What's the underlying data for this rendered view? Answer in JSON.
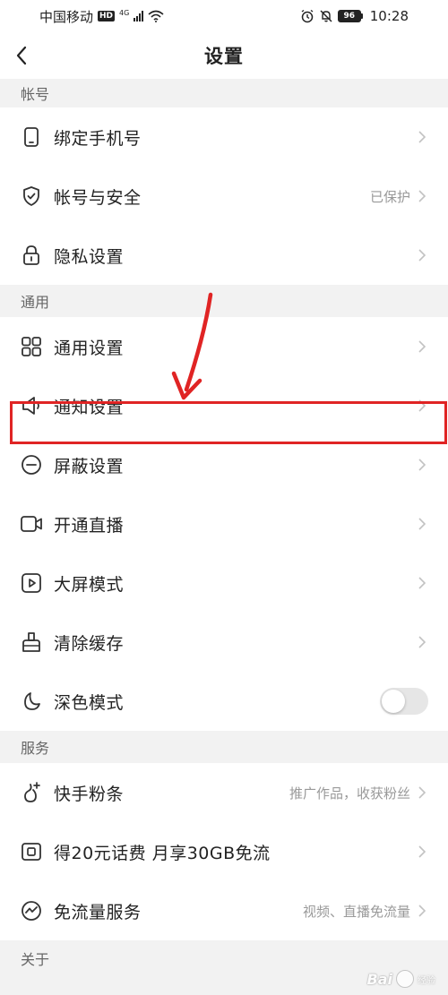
{
  "status_bar": {
    "carrier": "中国移动",
    "hd": "HD",
    "network": "4G",
    "battery": "96",
    "time": "10:28"
  },
  "nav": {
    "title": "设置"
  },
  "sections": {
    "account": {
      "header": "帐号",
      "items": [
        {
          "label": "绑定手机号",
          "value": "",
          "icon": "phone-icon"
        },
        {
          "label": "帐号与安全",
          "value": "已保护",
          "icon": "shield-check-icon"
        },
        {
          "label": "隐私设置",
          "value": "",
          "icon": "lock-icon"
        }
      ]
    },
    "general": {
      "header": "通用",
      "items": [
        {
          "label": "通用设置",
          "value": "",
          "icon": "grid-icon"
        },
        {
          "label": "通知设置",
          "value": "",
          "icon": "speaker-icon"
        },
        {
          "label": "屏蔽设置",
          "value": "",
          "icon": "block-minus-icon"
        },
        {
          "label": "开通直播",
          "value": "",
          "icon": "video-camera-icon"
        },
        {
          "label": "大屏模式",
          "value": "",
          "icon": "play-screen-icon"
        },
        {
          "label": "清除缓存",
          "value": "",
          "icon": "brush-icon"
        },
        {
          "label": "深色模式",
          "value": "",
          "icon": "moon-icon",
          "toggle": false
        }
      ]
    },
    "services": {
      "header": "服务",
      "items": [
        {
          "label": "快手粉条",
          "value": "推广作品，收获粉丝",
          "icon": "flame-plus-icon"
        },
        {
          "label": "得20元话费 月享30GB免流",
          "value": "",
          "icon": "sim-card-icon"
        },
        {
          "label": "免流量服务",
          "value": "视频、直播免流量",
          "icon": "wave-circle-icon"
        }
      ]
    },
    "about": {
      "header": "关于"
    }
  },
  "watermark": {
    "text": "Bai",
    "sub": "经验"
  },
  "colors": {
    "highlight": "#e02424",
    "background": "#f2f2f2",
    "card": "#ffffff"
  }
}
